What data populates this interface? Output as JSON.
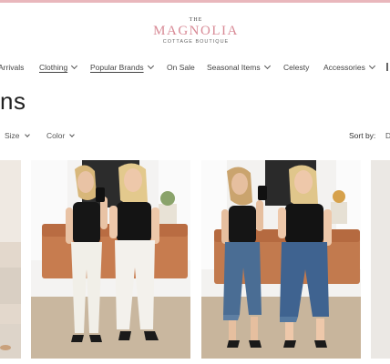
{
  "brand": {
    "the": "THE",
    "name": "MAGNOLIA",
    "tagline": "COTTAGE BOUTIQUE"
  },
  "nav": {
    "items": [
      {
        "label": "Arrivals",
        "has_dropdown": false,
        "underlined": false
      },
      {
        "label": "Clothing",
        "has_dropdown": true,
        "underlined": true
      },
      {
        "label": "Popular Brands",
        "has_dropdown": true,
        "underlined": true
      },
      {
        "label": "On Sale",
        "has_dropdown": false,
        "underlined": false
      },
      {
        "label": "Seasonal Items",
        "has_dropdown": true,
        "underlined": false
      },
      {
        "label": "Celesty",
        "has_dropdown": false,
        "underlined": false
      },
      {
        "label": "Accessories",
        "has_dropdown": true,
        "underlined": false
      }
    ]
  },
  "page": {
    "title": "ns"
  },
  "filters": {
    "size_label": "Size",
    "color_label": "Color",
    "sort_label": "Sort by:",
    "sort_value": "D"
  },
  "products": [
    {
      "image": "partial-image-left"
    },
    {
      "image": "two-women-white-jeans-mirror-selfie"
    },
    {
      "image": "two-women-blue-cropped-jeans-mirror-selfie"
    },
    {
      "image": "partial-image-right"
    }
  ],
  "colors": {
    "accent_pink": "#e9b7bc",
    "logo_pink": "#d88a96"
  }
}
